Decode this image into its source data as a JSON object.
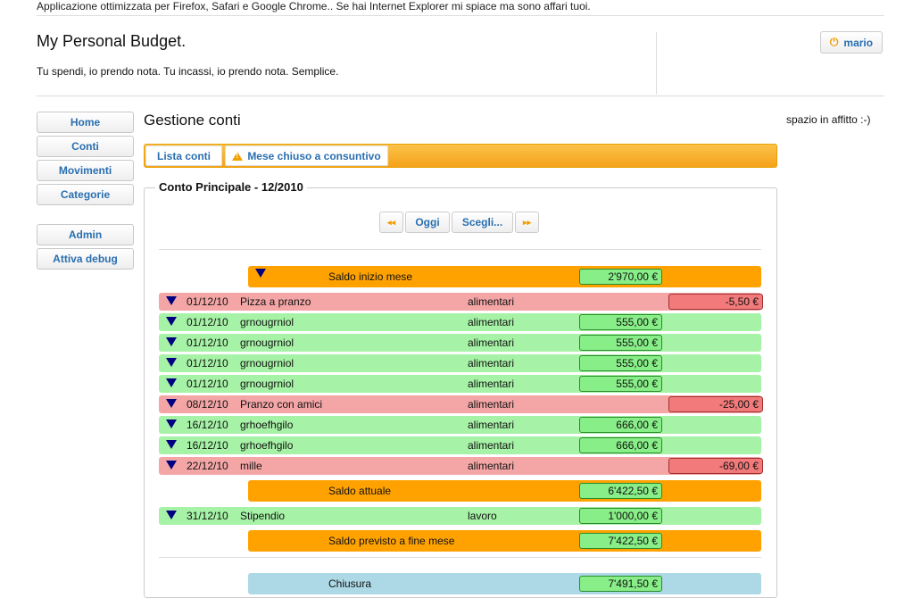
{
  "top_note": "Applicazione ottimizzata per Firefox, Safari e Google Chrome.. Se hai Internet Explorer mi spiace ma sono affari tuoi.",
  "site": {
    "title": "My Personal Budget.",
    "tagline": "Tu spendi, io prendo nota. Tu incassi, io prendo nota. Semplice."
  },
  "user": {
    "name": "mario",
    "icon": "power-icon"
  },
  "sidebar": {
    "items": [
      {
        "label": "Home"
      },
      {
        "label": "Conti"
      },
      {
        "label": "Movimenti"
      },
      {
        "label": "Categorie"
      },
      {
        "label": "Admin"
      },
      {
        "label": "Attiva debug"
      }
    ]
  },
  "ad_text": "spazio in affitto :-)",
  "page_title": "Gestione conti",
  "tabs": [
    {
      "label": "Lista conti"
    },
    {
      "label": "Mese chiuso a consuntivo",
      "icon": "warning-icon"
    }
  ],
  "account": {
    "legend": "Conto Principale - 12/2010",
    "nav": {
      "prev": "◂◂",
      "today": "Oggi",
      "choose": "Scegli...",
      "next": "▸▸"
    },
    "opening": {
      "label": "Saldo inizio mese",
      "amount": "2'970,00 €"
    },
    "movements": [
      {
        "date": "01/12/10",
        "desc": "Pizza a pranzo",
        "category": "alimentari",
        "amount": "-5,50 €",
        "type": "out"
      },
      {
        "date": "01/12/10",
        "desc": "grnougrniol",
        "category": "alimentari",
        "amount": "555,00 €",
        "type": "in"
      },
      {
        "date": "01/12/10",
        "desc": "grnougrniol",
        "category": "alimentari",
        "amount": "555,00 €",
        "type": "in"
      },
      {
        "date": "01/12/10",
        "desc": "grnougrniol",
        "category": "alimentari",
        "amount": "555,00 €",
        "type": "in"
      },
      {
        "date": "01/12/10",
        "desc": "grnougrniol",
        "category": "alimentari",
        "amount": "555,00 €",
        "type": "in"
      },
      {
        "date": "08/12/10",
        "desc": "Pranzo con amici",
        "category": "alimentari",
        "amount": "-25,00 €",
        "type": "out"
      },
      {
        "date": "16/12/10",
        "desc": "grhoefhgilo",
        "category": "alimentari",
        "amount": "666,00 €",
        "type": "in"
      },
      {
        "date": "16/12/10",
        "desc": "grhoefhgilo",
        "category": "alimentari",
        "amount": "666,00 €",
        "type": "in"
      },
      {
        "date": "22/12/10",
        "desc": "mille",
        "category": "alimentari",
        "amount": "-69,00 €",
        "type": "out"
      }
    ],
    "current": {
      "label": "Saldo attuale",
      "amount": "6'422,50 €"
    },
    "future_movements": [
      {
        "date": "31/12/10",
        "desc": "Stipendio",
        "category": "lavoro",
        "amount": "1'000,00 €",
        "type": "in"
      }
    ],
    "forecast": {
      "label": "Saldo previsto a fine mese",
      "amount": "7'422,50 €"
    },
    "closing": {
      "label": "Chiusura",
      "amount": "7'491,50 €"
    }
  }
}
